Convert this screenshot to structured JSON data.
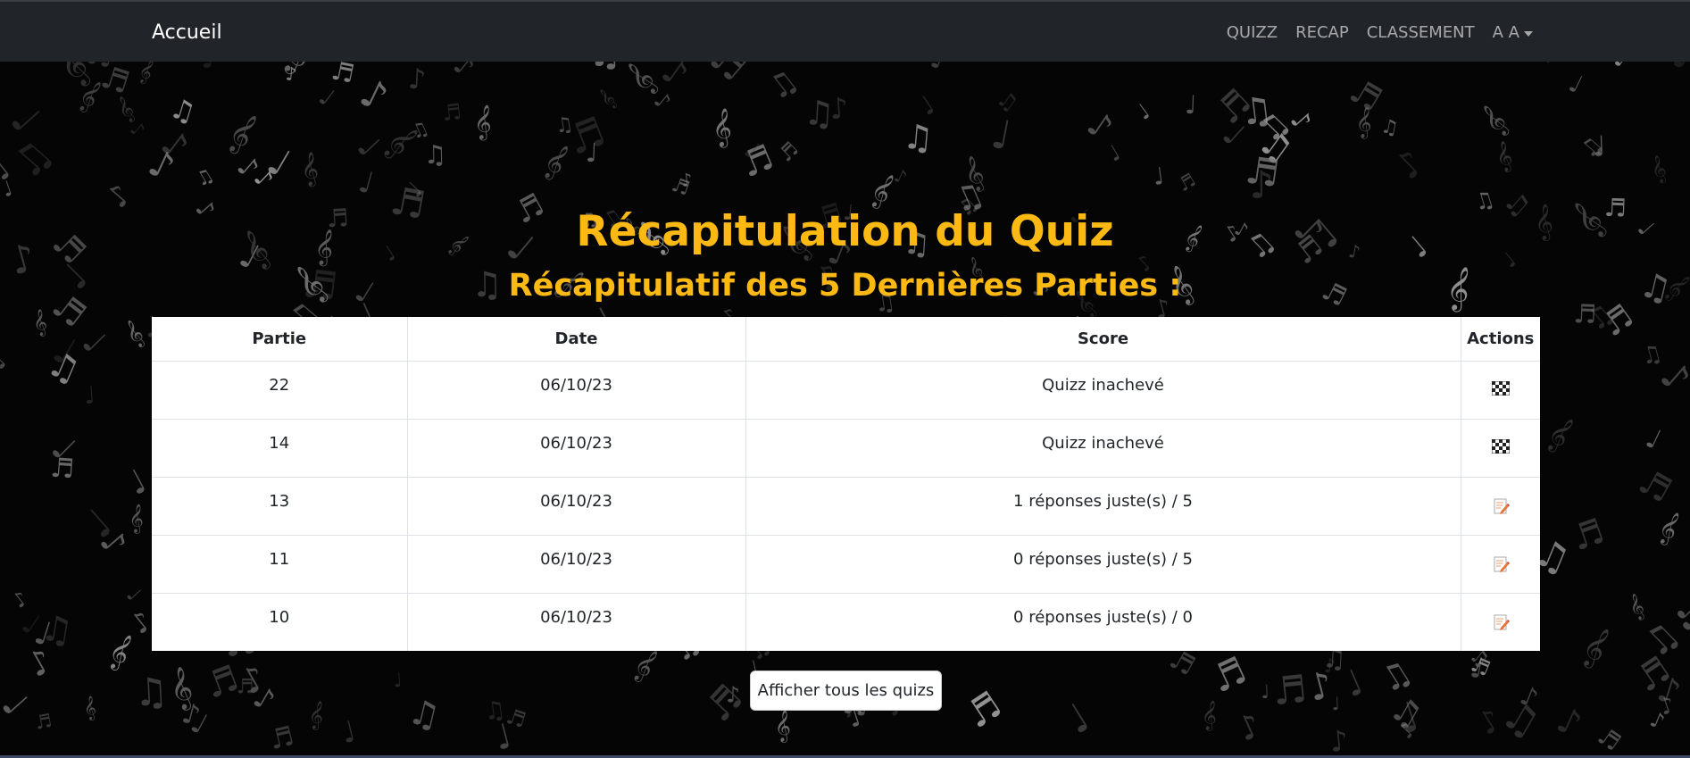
{
  "navbar": {
    "brand": "Accueil",
    "links": [
      {
        "label": "QUIZZ"
      },
      {
        "label": "RECAP"
      },
      {
        "label": "CLASSEMENT"
      }
    ],
    "user_menu": {
      "label": "A A",
      "icon": "caret-down-icon"
    }
  },
  "page": {
    "title": "Récapitulation du Quiz",
    "subtitle": "Récapitulatif des 5 Dernières Parties :"
  },
  "table": {
    "headers": [
      "Partie",
      "Date",
      "Score",
      "Actions"
    ],
    "rows": [
      {
        "partie": "22",
        "date": "06/10/23",
        "score": "Quizz inachevé",
        "action_icon": "checkered-flag-icon"
      },
      {
        "partie": "14",
        "date": "06/10/23",
        "score": "Quizz inachevé",
        "action_icon": "checkered-flag-icon"
      },
      {
        "partie": "13",
        "date": "06/10/23",
        "score": "1 réponses juste(s) / 5",
        "action_icon": "edit-document-icon"
      },
      {
        "partie": "11",
        "date": "06/10/23",
        "score": "0 réponses juste(s) / 5",
        "action_icon": "edit-document-icon"
      },
      {
        "partie": "10",
        "date": "06/10/23",
        "score": "0 réponses juste(s) / 0",
        "action_icon": "edit-document-icon"
      }
    ]
  },
  "buttons": {
    "show_all": "Afficher tous les quizs"
  },
  "colors": {
    "navbar_bg": "#212529",
    "title": "#fcb913",
    "background": "#050505"
  }
}
